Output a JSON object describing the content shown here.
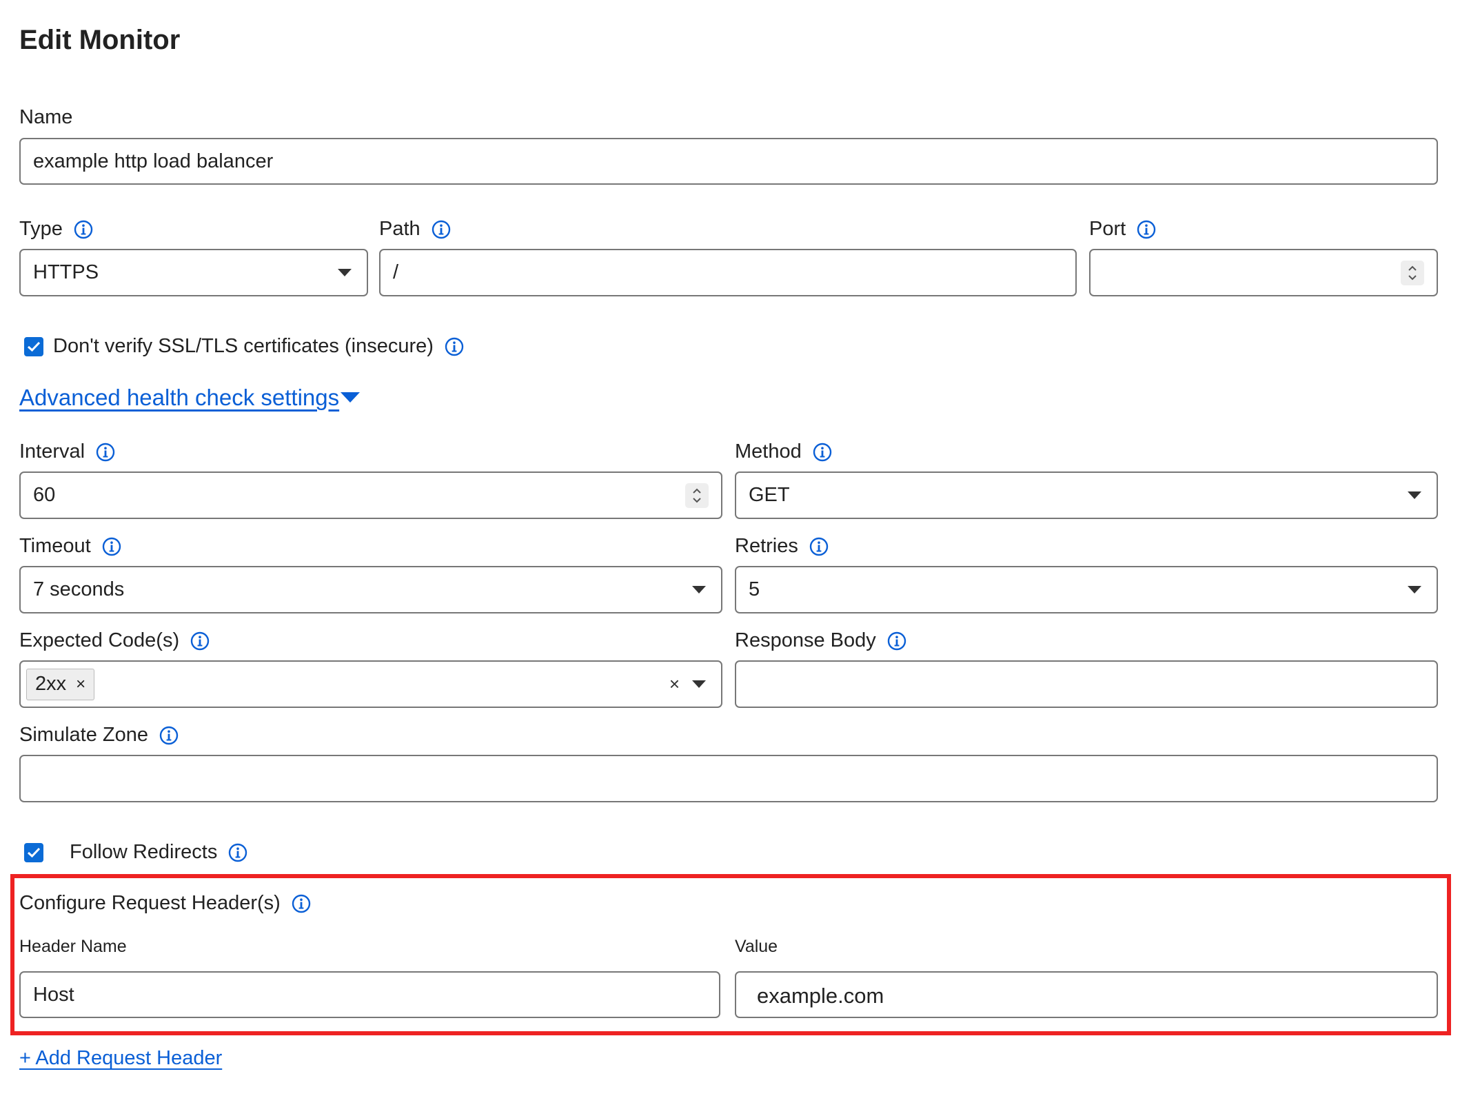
{
  "page": {
    "title": "Edit Monitor"
  },
  "name": {
    "label": "Name",
    "value": "example http load balancer"
  },
  "type": {
    "label": "Type",
    "value": "HTTPS"
  },
  "path": {
    "label": "Path",
    "value": "/"
  },
  "port": {
    "label": "Port",
    "value": ""
  },
  "ssl": {
    "label": "Don't verify SSL/TLS certificates (insecure)",
    "checked": true
  },
  "advanced": {
    "label": "Advanced health check settings"
  },
  "interval": {
    "label": "Interval",
    "value": "60"
  },
  "method": {
    "label": "Method",
    "value": "GET"
  },
  "timeout": {
    "label": "Timeout",
    "value": "7 seconds"
  },
  "retries": {
    "label": "Retries",
    "value": "5"
  },
  "expected_codes": {
    "label": "Expected Code(s)",
    "chips": [
      "2xx"
    ],
    "chip_remove": "×",
    "clear": "×"
  },
  "response_body": {
    "label": "Response Body",
    "value": ""
  },
  "simulate_zone": {
    "label": "Simulate Zone",
    "value": ""
  },
  "follow_redirects": {
    "label": "Follow Redirects",
    "checked": true
  },
  "request_headers": {
    "title": "Configure Request Header(s)",
    "name_label": "Header Name",
    "value_label": "Value",
    "name_value": "Host",
    "value_value": "example.com"
  },
  "add_header": {
    "label": "+ Add Request Header"
  },
  "colors": {
    "accent": "#0a5fd6",
    "highlight": "#ee2222",
    "border": "#777777"
  },
  "icons": {
    "info": "info-circle-icon",
    "caret": "caret-down-icon",
    "check": "check-icon",
    "spinner": "spinner-arrows-icon"
  }
}
